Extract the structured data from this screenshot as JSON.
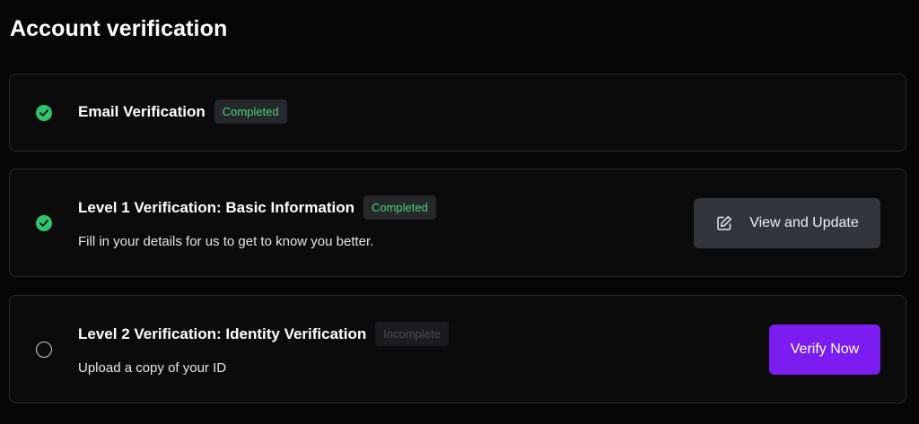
{
  "page": {
    "title": "Account verification"
  },
  "cards": [
    {
      "title": "Email Verification",
      "status": "Completed",
      "status_state": "completed",
      "status_icon": "check-circle-icon",
      "description": ""
    },
    {
      "title": "Level 1 Verification: Basic Information",
      "status": "Completed",
      "status_state": "completed",
      "status_icon": "check-circle-icon",
      "description": "Fill in your details for us to get to know you better.",
      "action": {
        "label": "View and Update",
        "icon": "edit-icon"
      }
    },
    {
      "title": "Level 2 Verification: Identity Verification",
      "status": "Incomplete",
      "status_state": "incomplete",
      "status_icon": "empty-circle-icon",
      "description": "Upload a copy of your ID",
      "action": {
        "label": "Verify Now"
      }
    }
  ],
  "colors": {
    "background": "#060606",
    "card_background": "#0b0b0b",
    "card_border": "#2b2b2b",
    "success": "#2fc46d",
    "completed_badge_text": "#4bd17e",
    "secondary_button": "#34353a",
    "primary_button": "#7b1cf0"
  }
}
